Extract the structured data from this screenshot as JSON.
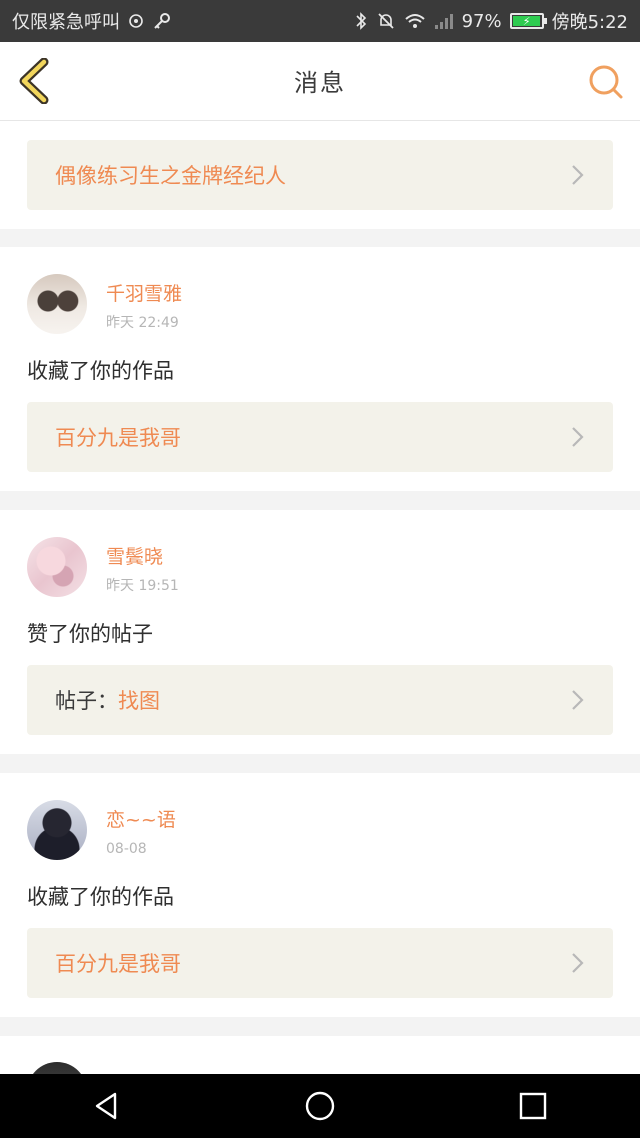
{
  "status_bar": {
    "carrier": "仅限紧急呼叫",
    "battery_percent": "97%",
    "battery_level": 0.97,
    "time": "傍晚5:22",
    "icons": [
      "sim-icon",
      "key-icon",
      "bluetooth-icon",
      "mute-icon",
      "wifi-icon",
      "signal-icon",
      "battery-icon"
    ]
  },
  "header": {
    "title": "消息",
    "back_icon": "back-chevron-icon",
    "search_icon": "search-icon",
    "accent": "#f0a05f"
  },
  "first_item": {
    "link": "偶像练习生之金牌经纪人"
  },
  "messages": [
    {
      "user": "千羽雪雅",
      "time": "昨天 22:49",
      "action": "收藏了你的作品",
      "ref": "百分九是我哥",
      "ref_prefix": ""
    },
    {
      "user": "雪鬓晓",
      "time": "昨天 19:51",
      "action": "赞了你的帖子",
      "ref": "找图",
      "ref_prefix": "帖子："
    },
    {
      "user": "恋~~语",
      "time": "08-08",
      "action": "收藏了你的作品",
      "ref": "百分九是我哥",
      "ref_prefix": ""
    }
  ],
  "colors": {
    "accent_orange": "#ef8a52",
    "ref_bg": "#f3f2ea",
    "divider": "#f3f3f3"
  },
  "system_nav": {
    "back": "nav-back-icon",
    "home": "nav-home-icon",
    "recents": "nav-recents-icon"
  }
}
